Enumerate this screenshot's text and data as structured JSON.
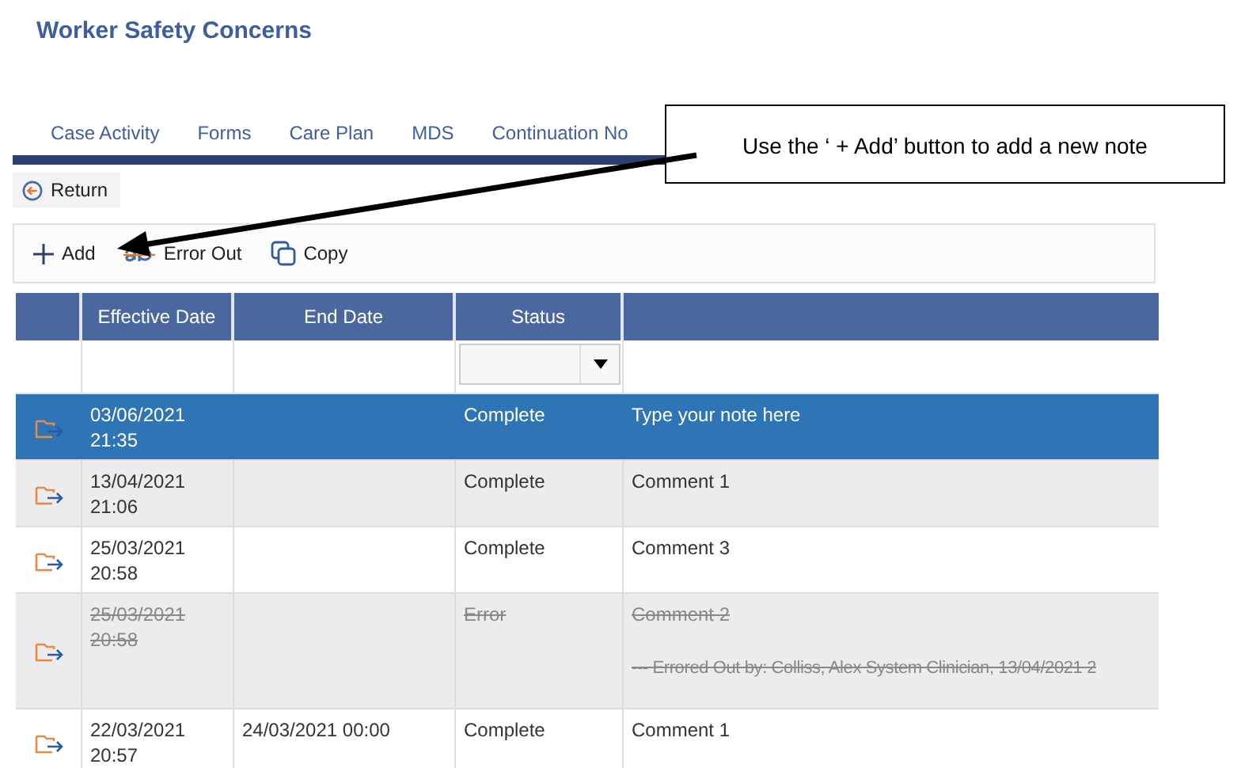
{
  "page": {
    "title": "Worker Safety Concerns"
  },
  "tabs": [
    {
      "label": "Case Activity"
    },
    {
      "label": "Forms"
    },
    {
      "label": "Care Plan"
    },
    {
      "label": "MDS"
    },
    {
      "label": "Continuation No"
    }
  ],
  "callout": {
    "text": "Use the ‘ + Add’ button to add a new note"
  },
  "return_button": {
    "label": "Return"
  },
  "toolbar": [
    {
      "kind": "add",
      "label": "Add"
    },
    {
      "kind": "error",
      "label": "Error Out"
    },
    {
      "kind": "copy",
      "label": "Copy"
    }
  ],
  "table": {
    "columns": [
      "Effective Date",
      "End Date",
      "Status"
    ],
    "rows": [
      {
        "effective_date": "03/06/2021",
        "effective_time": "21:35",
        "status": "Complete",
        "note": "Type your note here",
        "selected": true,
        "errored": false
      },
      {
        "effective_date": "13/04/2021",
        "effective_time": "21:06",
        "status": "Complete",
        "note": "Comment 1",
        "selected": false,
        "errored": false
      },
      {
        "effective_date": "25/03/2021",
        "effective_time": "20:58",
        "status": "Complete",
        "note": "Comment 3",
        "selected": false,
        "errored": false
      },
      {
        "effective_date": "25/03/2021",
        "effective_time": "20:58",
        "status": "Error",
        "note": "Comment 2",
        "note_detail": "--- Errored Out by: Colliss, Alex System Clinician, 13/04/2021 2",
        "selected": false,
        "errored": true
      },
      {
        "effective_date": "22/03/2021",
        "effective_time": "20:57",
        "end_date": "24/03/2021 00:00",
        "status": "Complete",
        "note": "Comment 1",
        "selected": false,
        "errored": false
      }
    ]
  }
}
